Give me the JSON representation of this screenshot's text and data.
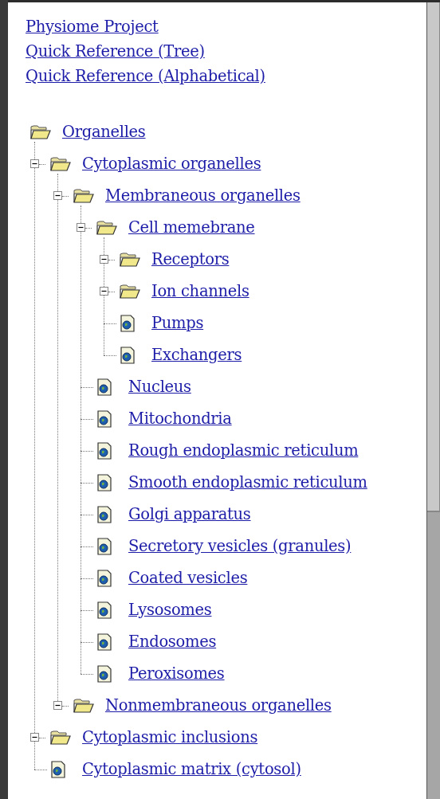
{
  "top_links": [
    "Physiome Project",
    "Quick Reference (Tree)",
    "Quick Reference (Alphabetical)"
  ],
  "tree": [
    {
      "label": "Organelles",
      "kind": "folder",
      "children": [
        {
          "label": "Cytoplasmic organelles",
          "kind": "folder",
          "expanded": true,
          "children": [
            {
              "label": "Membraneous organelles",
              "kind": "folder",
              "expanded": true,
              "children": [
                {
                  "label": "Cell memebrane",
                  "kind": "folder",
                  "expanded": true,
                  "children": [
                    {
                      "label": "Receptors",
                      "kind": "folder",
                      "expanded": true
                    },
                    {
                      "label": "Ion channels",
                      "kind": "folder",
                      "expanded": true
                    },
                    {
                      "label": "Pumps",
                      "kind": "page"
                    },
                    {
                      "label": "Exchangers",
                      "kind": "page"
                    }
                  ]
                },
                {
                  "label": "Nucleus",
                  "kind": "page"
                },
                {
                  "label": "Mitochondria",
                  "kind": "page"
                },
                {
                  "label": "Rough endoplasmic reticulum",
                  "kind": "page"
                },
                {
                  "label": "Smooth endoplasmic reticulum",
                  "kind": "page"
                },
                {
                  "label": "Golgi apparatus",
                  "kind": "page"
                },
                {
                  "label": "Secretory vesicles (granules)",
                  "kind": "page"
                },
                {
                  "label": "Coated vesicles",
                  "kind": "page"
                },
                {
                  "label": "Lysosomes",
                  "kind": "page"
                },
                {
                  "label": "Endosomes",
                  "kind": "page"
                },
                {
                  "label": "Peroxisomes",
                  "kind": "page"
                }
              ]
            },
            {
              "label": "Nonmembraneous organelles",
              "kind": "folder",
              "expanded": true
            }
          ]
        },
        {
          "label": "Cytoplasmic inclusions",
          "kind": "folder",
          "expanded": true
        },
        {
          "label": "Cytoplasmic matrix (cytosol)",
          "kind": "page"
        }
      ]
    }
  ]
}
